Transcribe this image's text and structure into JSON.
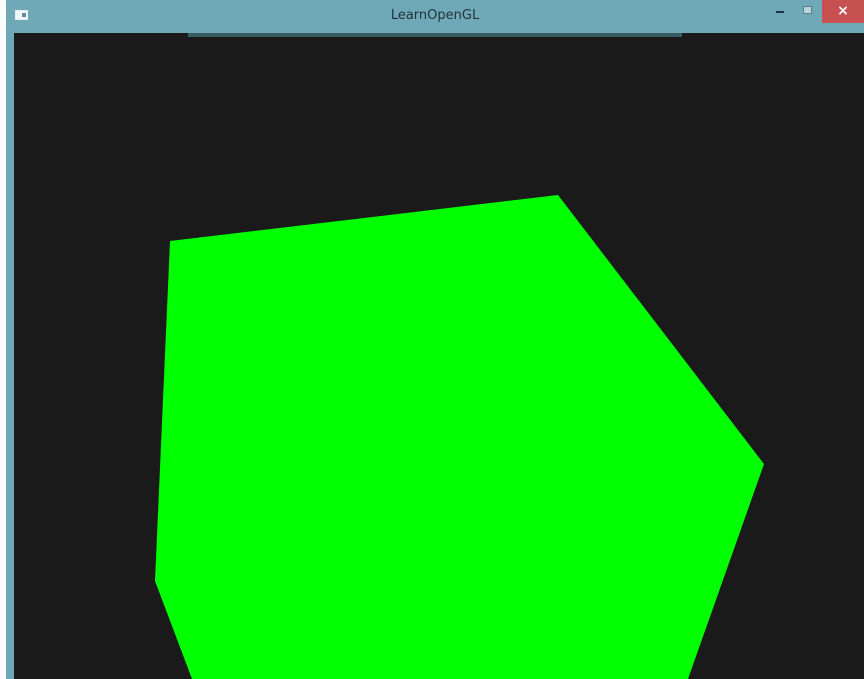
{
  "window": {
    "title": "LearnOpenGL",
    "icon": "app-window-icon",
    "controls": {
      "minimize_icon": "minimize-icon",
      "maximize_icon": "maximize-icon",
      "close_icon": "close-icon",
      "close_glyph": "×"
    }
  },
  "canvas": {
    "background_color": "#1a1a1a",
    "shape": {
      "kind": "polygon",
      "fill_color": "#00ff00"
    }
  },
  "colors": {
    "titlebar": "#6fa8b7",
    "close_button": "#c75050"
  }
}
